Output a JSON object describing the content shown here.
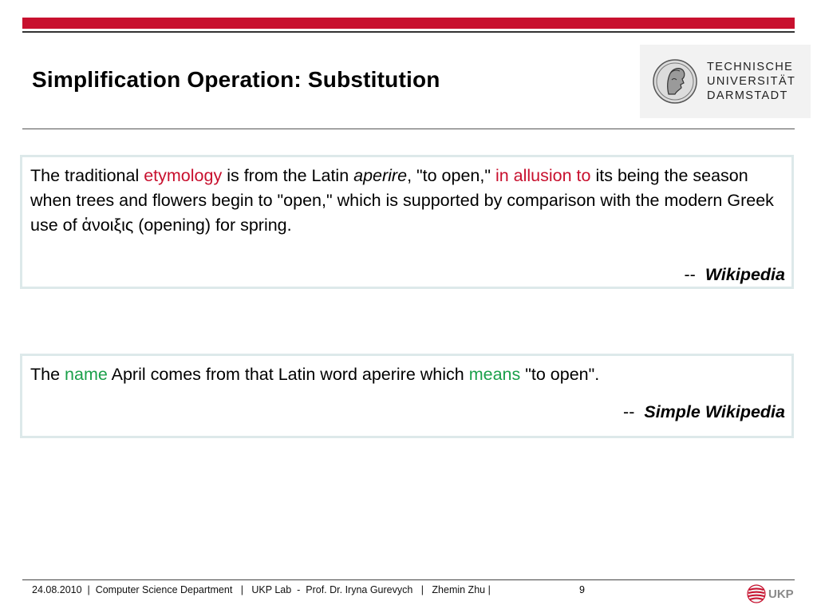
{
  "slide": {
    "title": "Simplification Operation: Substitution"
  },
  "logo": {
    "lines": [
      "TECHNISCHE",
      "UNIVERSITÄT",
      "DARMSTADT"
    ]
  },
  "quote1": {
    "t1": "The traditional ",
    "w1": "etymology",
    "t2": " is from the Latin ",
    "w2": "aperire",
    "t3": ", \"to open,\" ",
    "w3": "in allusion to",
    "t4": " its being the season when trees and flowers begin to \"open,\" which is supported by comparison with the modern Greek use of ἁνοιξις (opening) for spring.",
    "dash": "--",
    "source": "Wikipedia"
  },
  "quote2": {
    "t1": "The ",
    "w1": "name",
    "t2": " April comes from that Latin word aperire which ",
    "w2": "means",
    "t3": " \"to open\".",
    "dash": "--",
    "source": "Simple Wikipedia"
  },
  "footer": {
    "text": "24.08.2010  |  Computer Science Department   |   UKP Lab  -  Prof. Dr. Iryna Gurevych   |   Zhemin Zhu |",
    "page": "9",
    "ukp_label": "UKP"
  },
  "colors": {
    "accent_red": "#c8102e",
    "highlight_green": "#1aa04a",
    "box_border": "#dde9ea"
  }
}
